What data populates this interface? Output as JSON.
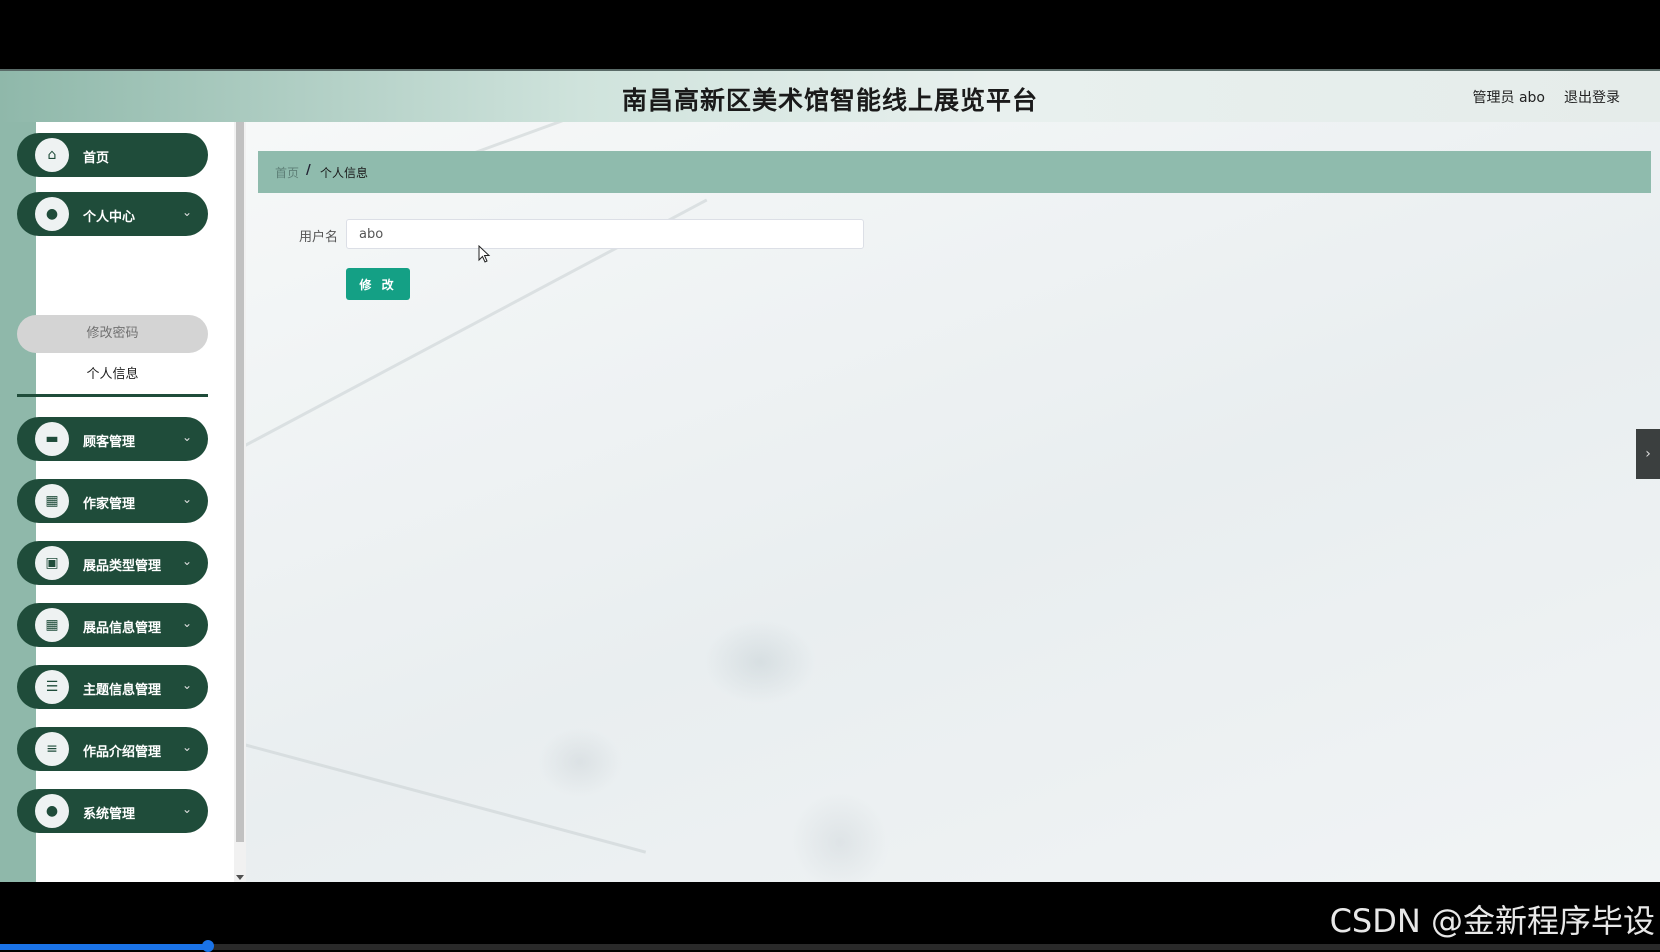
{
  "header": {
    "title": "南昌高新区美术馆智能线上展览平台",
    "user_info": "管理员 abo",
    "logout_label": "退出登录"
  },
  "sidebar": {
    "items": [
      {
        "label": "首页",
        "icon": "home-icon",
        "glyph": "⌂",
        "has_chevron": false
      },
      {
        "label": "个人中心",
        "icon": "user-icon",
        "glyph": "●",
        "has_chevron": true
      },
      {
        "label": "顾客管理",
        "icon": "customer-icon",
        "glyph": "▬",
        "has_chevron": true
      },
      {
        "label": "作家管理",
        "icon": "grid-icon",
        "glyph": "▦",
        "has_chevron": true
      },
      {
        "label": "展品类型管理",
        "icon": "briefcase-icon",
        "glyph": "▣",
        "has_chevron": true
      },
      {
        "label": "展品信息管理",
        "icon": "grid-icon",
        "glyph": "▦",
        "has_chevron": true
      },
      {
        "label": "主题信息管理",
        "icon": "sliders-icon",
        "glyph": "☰",
        "has_chevron": true
      },
      {
        "label": "作品介绍管理",
        "icon": "list-icon",
        "glyph": "≡",
        "has_chevron": true
      },
      {
        "label": "系统管理",
        "icon": "user-icon",
        "glyph": "●",
        "has_chevron": true
      }
    ],
    "submenu": {
      "change_password": "修改密码",
      "personal_info": "个人信息"
    }
  },
  "breadcrumb": {
    "home": "首页",
    "separator": "/",
    "current": "个人信息"
  },
  "form": {
    "username_label": "用户名",
    "username_value": "abo",
    "submit_label": "修 改"
  },
  "watermark": "CSDN @金新程序毕设",
  "video_progress": 0.125,
  "colors": {
    "sidebar_item": "#1f4c3a",
    "accent_button": "#14a085",
    "breadcrumb_bg": "#8fbbad"
  }
}
